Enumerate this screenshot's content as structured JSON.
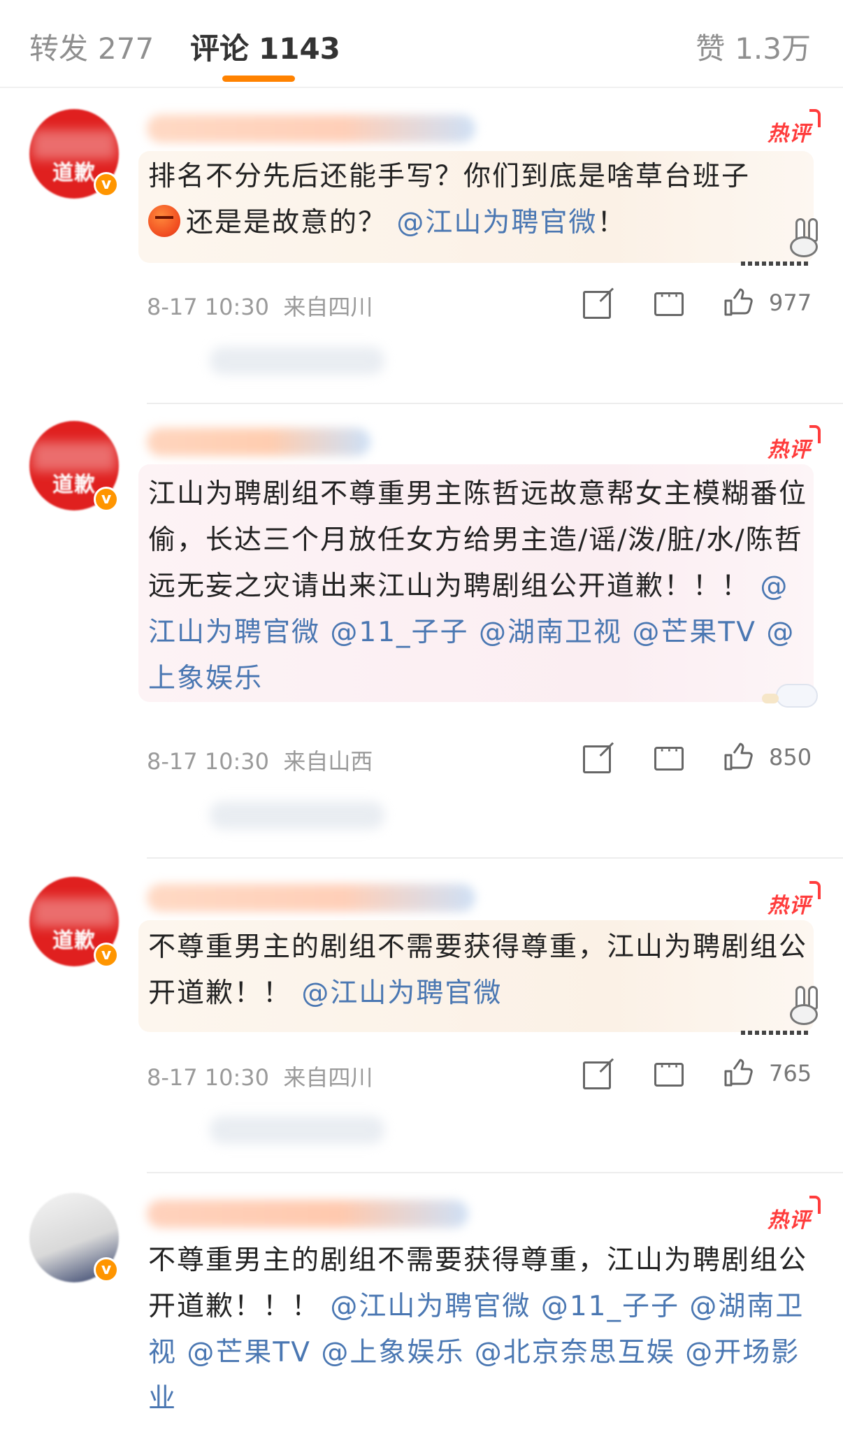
{
  "tabs": {
    "repost": {
      "label": "转发",
      "count": "277"
    },
    "comment": {
      "label": "评论",
      "count": "1143"
    },
    "like": {
      "label": "赞",
      "count": "1.3万"
    }
  },
  "colors": {
    "accent": "#ff8200",
    "mention": "#4a77b2",
    "hot": "#ff3c3c",
    "verified": "#ff9500"
  },
  "comments": [
    {
      "avatar_text": "道歉",
      "badge": "热评",
      "text_parts": [
        "排名不分先后还能手写？你们到底是啥草台班子",
        "还是是故意的？",
        "@江山为聘官微",
        "！"
      ],
      "emoji": "angry-face-icon",
      "time": "8-17 10:30",
      "location": "来自四川",
      "likes": "977"
    },
    {
      "avatar_text": "道歉",
      "badge": "热评",
      "text_parts": [
        "江山为聘剧组不尊重男主陈哲远故意帮女主模糊番位偷，长达三个月放任女方给男主造/谣/泼/脏/水/陈哲远无妄之灾请出来江山为聘剧组公开道歉！！！ ",
        "@江山为聘官微",
        " ",
        "@11_子子",
        " ",
        "@湖南卫视",
        " ",
        "@芒果TV",
        " ",
        "@上象娱乐"
      ],
      "time": "8-17 10:30",
      "location": "来自山西",
      "likes": "850"
    },
    {
      "avatar_text": "道歉",
      "badge": "热评",
      "text_parts": [
        "不尊重男主的剧组不需要获得尊重，江山为聘剧组公开道歉！！ ",
        "@江山为聘官微"
      ],
      "time": "8-17 10:30",
      "location": "来自四川",
      "likes": "765"
    },
    {
      "avatar_text": "",
      "badge": "热评",
      "text_parts": [
        "不尊重男主的剧组不需要获得尊重，江山为聘剧组公开道歉！！！ ",
        "@江山为聘官微",
        " ",
        "@11_子子",
        " ",
        "@湖南卫视",
        " ",
        "@芒果TV",
        " ",
        "@上象娱乐",
        " ",
        "@北京奈思互娱",
        " ",
        "@开场影业"
      ]
    }
  ]
}
